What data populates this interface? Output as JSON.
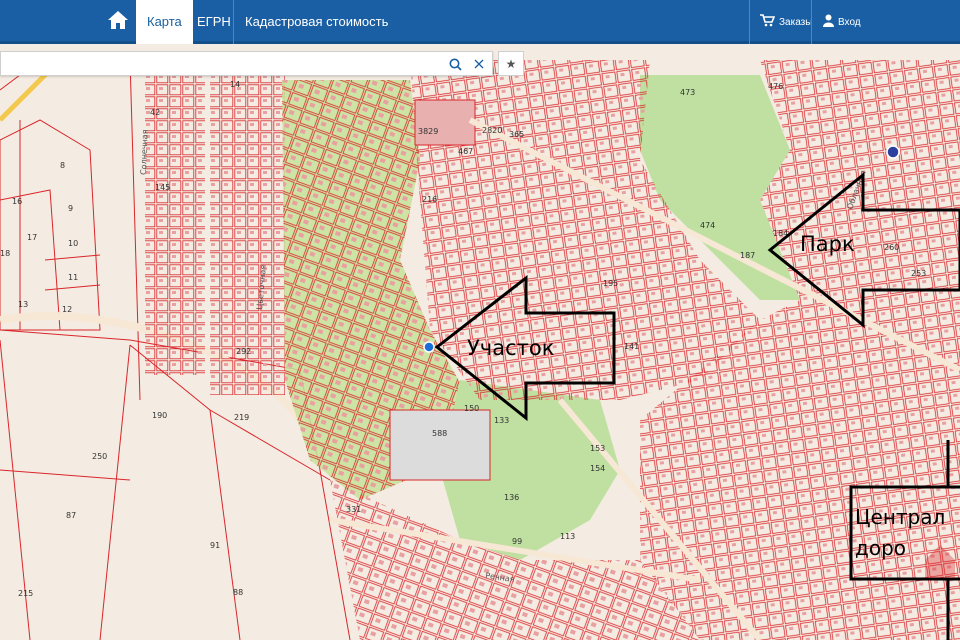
{
  "header": {
    "tabs": [
      {
        "label": "Карта",
        "active": true
      },
      {
        "label": "ЕГРН",
        "active": false
      },
      {
        "label": "Кадастровая стоимость",
        "active": false
      }
    ],
    "orders_label": "Заказы",
    "login_label": "Вход"
  },
  "search": {
    "value": "",
    "placeholder": ""
  },
  "annotations": {
    "plot_label": "Участок",
    "park_label": "Парк",
    "road_label_line1": "Централ",
    "road_label_line2": "доро"
  },
  "map": {
    "parcel_numbers": [
      "14",
      "42",
      "145",
      "16",
      "9",
      "17",
      "10",
      "18",
      "11",
      "12",
      "13",
      "8",
      "190",
      "219",
      "250",
      "87",
      "91",
      "88",
      "215",
      "588",
      "467",
      "473",
      "476",
      "474",
      "184",
      "187",
      "195",
      "141",
      "153",
      "154",
      "113",
      "99",
      "260",
      "253",
      "331",
      "216",
      "3829",
      "2820",
      "365",
      "292",
      "150",
      "133",
      "136"
    ],
    "streets": [
      "Солнечная",
      "Цветочная",
      "Облачная",
      "Речная"
    ]
  },
  "colors": {
    "header": "#1a5fa3",
    "parcel_line": "#d9262b",
    "park_green": "#bfe0a0",
    "highlight_green": "#c6e39a",
    "map_bg": "#f4ece2"
  }
}
